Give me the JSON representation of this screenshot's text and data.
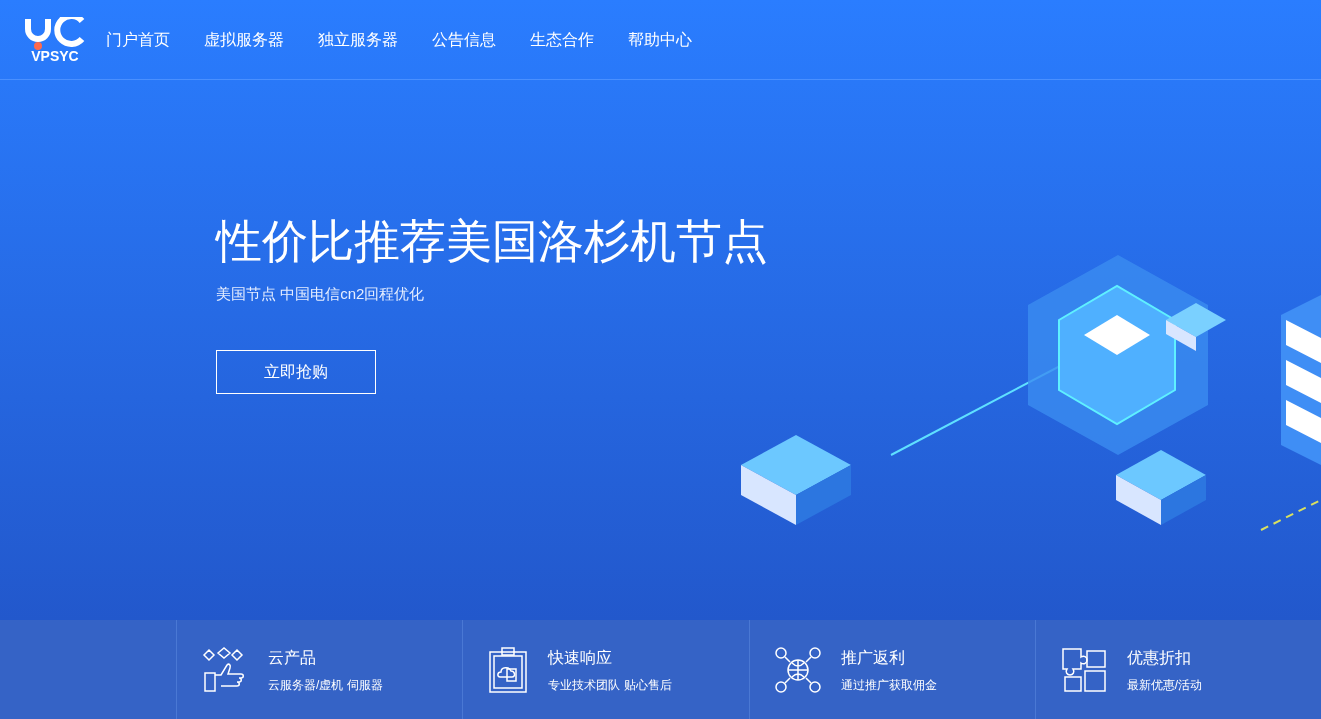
{
  "logo": {
    "text": "VPSYC"
  },
  "nav": [
    {
      "label": "门户首页"
    },
    {
      "label": "虚拟服务器"
    },
    {
      "label": "独立服务器"
    },
    {
      "label": "公告信息"
    },
    {
      "label": "生态合作"
    },
    {
      "label": "帮助中心"
    }
  ],
  "hero": {
    "title": "性价比推荐美国洛杉机节点",
    "subtitle": "美国节点 中国电信cn2回程优化",
    "button": "立即抢购"
  },
  "features": [
    {
      "kind": "products",
      "title": "云产品",
      "desc": "云服务器/虚机 伺服器"
    },
    {
      "kind": "response",
      "title": "快速响应",
      "desc": "专业技术团队 贴心售后"
    },
    {
      "kind": "referral",
      "title": "推广返利",
      "desc": "通过推广获取佣金"
    },
    {
      "kind": "discount",
      "title": "优惠折扣",
      "desc": "最新优惠/活动"
    }
  ]
}
